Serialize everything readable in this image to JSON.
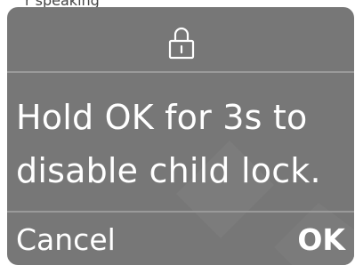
{
  "background": {
    "partial_text": "r speaking"
  },
  "dialog": {
    "icon": "lock-icon",
    "message_line1": "Hold OK for 3s to",
    "message_line2": "disable child lock.",
    "cancel_label": "Cancel",
    "ok_label": "OK"
  },
  "colors": {
    "dialog_bg": "#777777",
    "divider": "#9a9a9a",
    "text": "#ffffff"
  }
}
